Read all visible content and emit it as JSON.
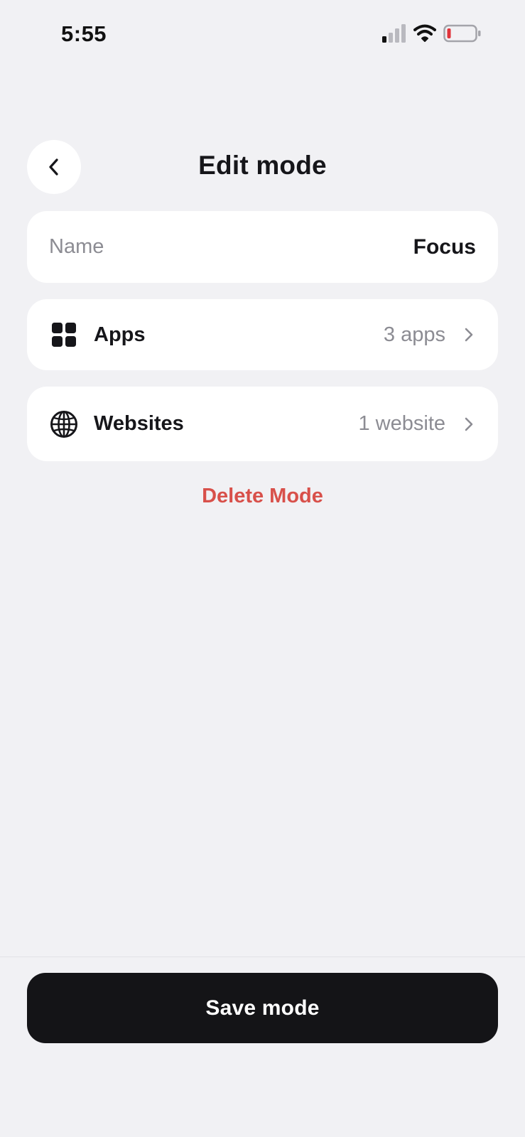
{
  "status_bar": {
    "time": "5:55",
    "battery_color": "#e0333a"
  },
  "header": {
    "back_icon": "chevron-left-icon",
    "title": "Edit mode"
  },
  "name_field": {
    "label": "Name",
    "value": "Focus"
  },
  "rows": [
    {
      "icon": "grid-icon",
      "label": "Apps",
      "value": "3 apps"
    },
    {
      "icon": "globe-icon",
      "label": "Websites",
      "value": "1 website"
    }
  ],
  "delete_label": "Delete Mode",
  "save_label": "Save mode",
  "colors": {
    "background": "#f1f1f4",
    "danger": "#d8504a",
    "primary_button": "#141417"
  }
}
